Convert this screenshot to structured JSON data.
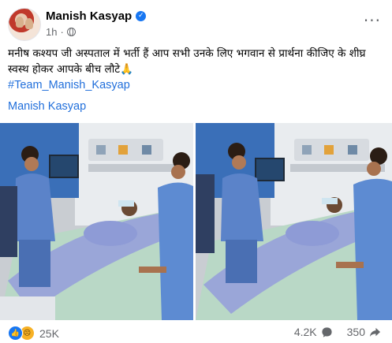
{
  "post": {
    "author": "Manish Kasyap",
    "time": "1h",
    "separator": "·",
    "text": "मनीष कश्यप जी अस्पताल में भर्ती हैं आप सभी उनके लिए भगवान से प्रार्थना कीजिए के शीघ्र स्वस्थ होकर आपके बीच लौटे🙏",
    "hashtag": "#Team_Manish_Kasyap",
    "page_link": "Manish Kasyap"
  },
  "icons": {
    "verified": "verified-badge-icon",
    "privacy": "globe-icon",
    "more": "more-options-icon",
    "like": "like-reaction-icon",
    "sad": "sad-reaction-icon",
    "comment": "comment-icon",
    "share": "share-icon"
  },
  "stats": {
    "reactions": "25K",
    "comments": "4.2K",
    "shares": "350"
  },
  "colors": {
    "brand_blue": "#1877f2",
    "link_blue": "#216fdb",
    "meta_gray": "#65676b"
  }
}
